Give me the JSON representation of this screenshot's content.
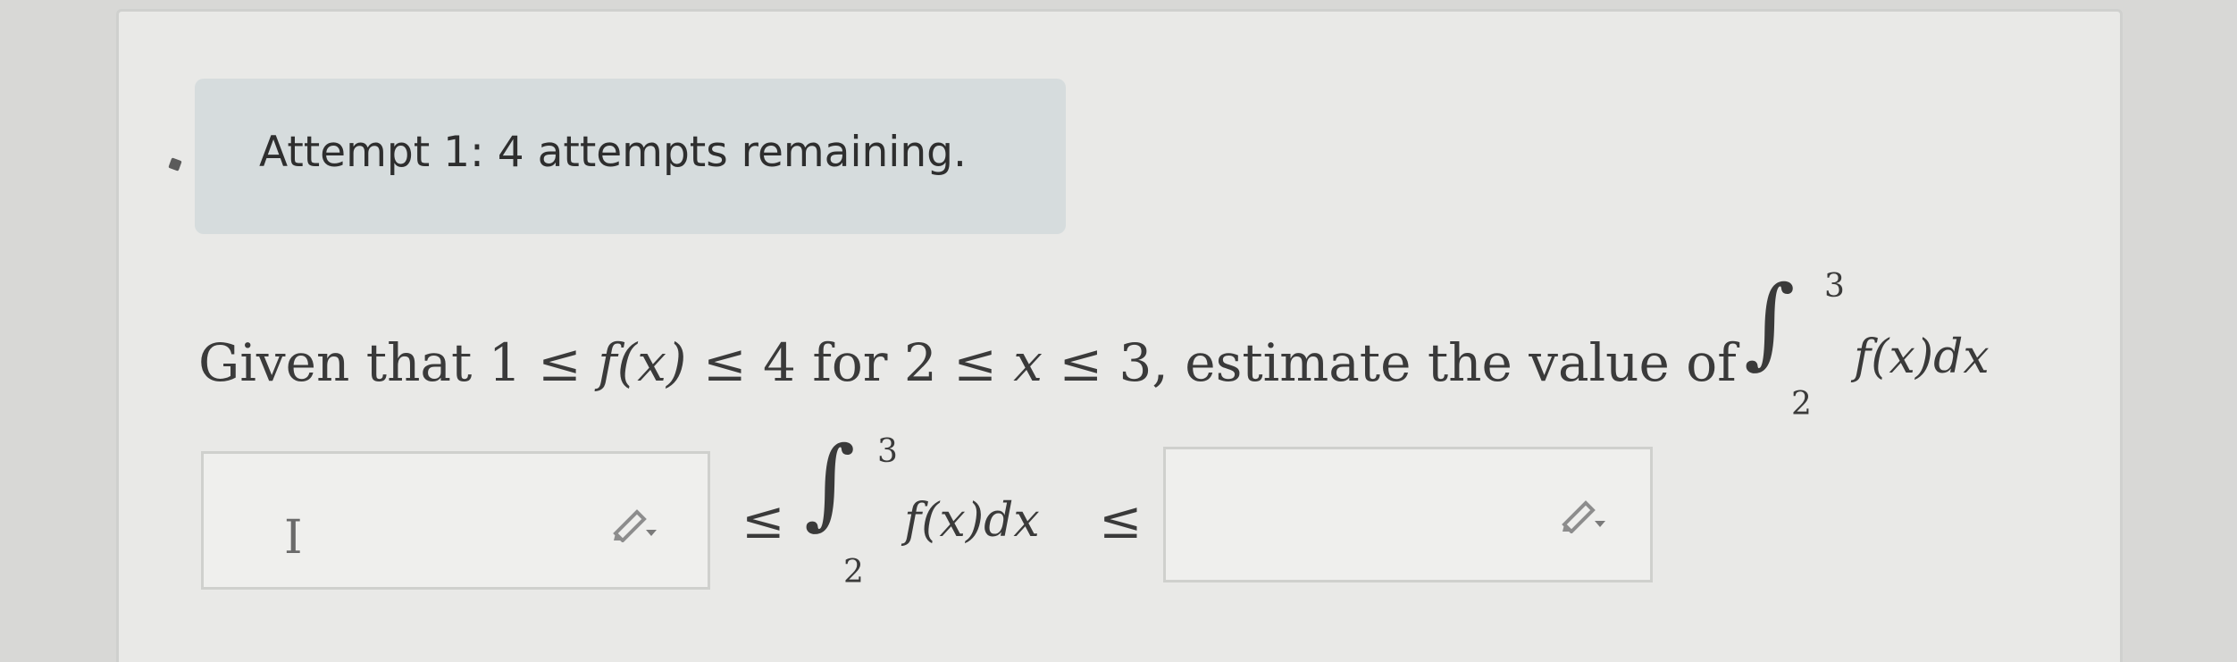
{
  "attempt": {
    "text": "Attempt 1: 4 attempts remaining."
  },
  "question": {
    "lead": "Given that ",
    "cond1_a": "1 ≤ ",
    "cond1_f": "f",
    "cond1_x": "(x)",
    "cond1_b": " ≤ 4",
    "for_text": " for ",
    "cond2_a": "2 ≤ ",
    "cond2_x": "x",
    "cond2_b": " ≤ 3",
    "tail": ", estimate the value of"
  },
  "integral": {
    "symbol": "∫",
    "upper": "3",
    "lower": "2",
    "integrand": "f(x)dx"
  },
  "inequality": {
    "left_rel": "≤",
    "right_rel": "≤"
  },
  "lower_bound_input": {
    "cursor": "I",
    "value": ""
  },
  "upper_bound_input": {
    "value": ""
  },
  "icons": {
    "lower_edit": "pencil-icon",
    "upper_edit": "pencil-icon",
    "collapse": "collapse-icon"
  }
}
